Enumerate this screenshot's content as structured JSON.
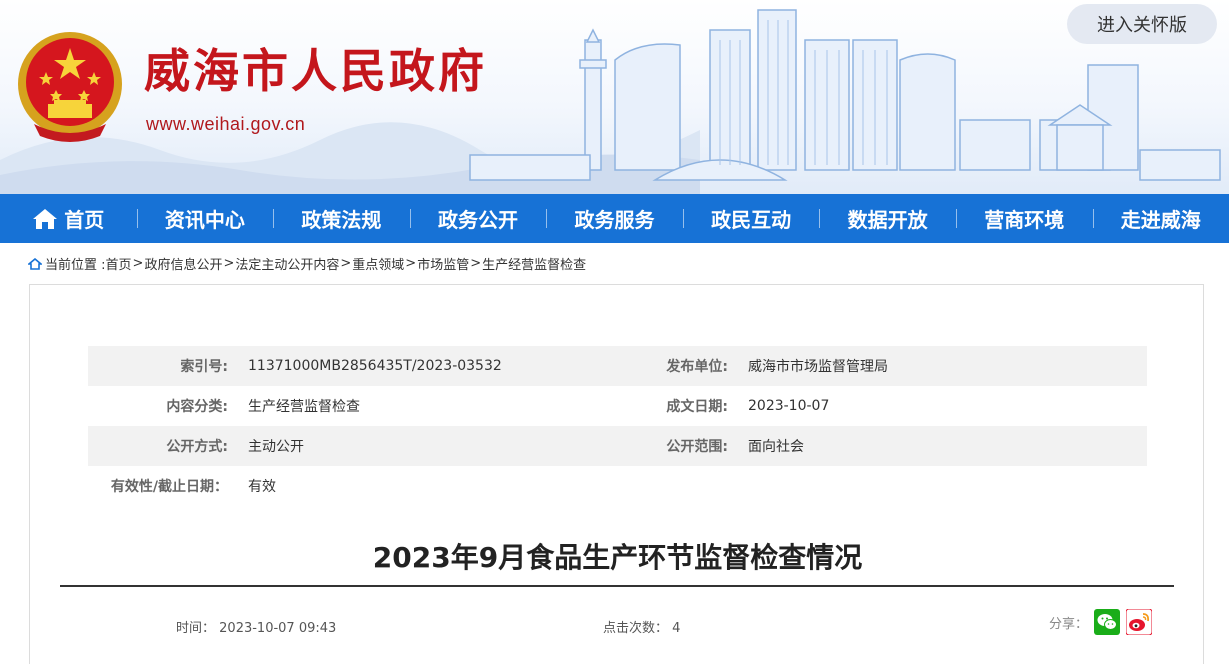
{
  "header": {
    "site_title": "威海市人民政府",
    "site_url": "www.weihai.gov.cn",
    "care_button": "进入关怀版"
  },
  "nav": {
    "items": [
      {
        "label": "首页",
        "icon": "home-icon"
      },
      {
        "label": "资讯中心"
      },
      {
        "label": "政策法规"
      },
      {
        "label": "政务公开"
      },
      {
        "label": "政务服务"
      },
      {
        "label": "政民互动"
      },
      {
        "label": "数据开放"
      },
      {
        "label": "营商环境"
      },
      {
        "label": "走进威海"
      }
    ]
  },
  "breadcrumb": {
    "prefix": "当前位置 :",
    "items": [
      "首页",
      "政府信息公开",
      "法定主动公开内容",
      "重点领域",
      "市场监管",
      "生产经营监督检查"
    ],
    "separator": ">"
  },
  "meta": {
    "index_label": "索引号:",
    "index_value": "11371000MB2856435T/2023-03532",
    "publisher_label": "发布单位:",
    "publisher_value": "威海市市场监督管理局",
    "category_label": "内容分类:",
    "category_value": "生产经营监督检查",
    "date_label": "成文日期:",
    "date_value": "2023-10-07",
    "method_label": "公开方式:",
    "method_value": "主动公开",
    "scope_label": "公开范围:",
    "scope_value": "面向社会",
    "validity_label": "有效性/截止日期：",
    "validity_value": "有效"
  },
  "article": {
    "title": "2023年9月食品生产环节监督检查情况",
    "time_label": "时间：",
    "time_value": "2023-10-07 09:43",
    "clicks_label": "点击次数：",
    "clicks_value": "4",
    "share_label": "分享："
  },
  "colors": {
    "brand_red": "#c4161c",
    "nav_blue": "#1772d6",
    "wechat_green": "#1aad19",
    "weibo_red": "#e6162d"
  }
}
